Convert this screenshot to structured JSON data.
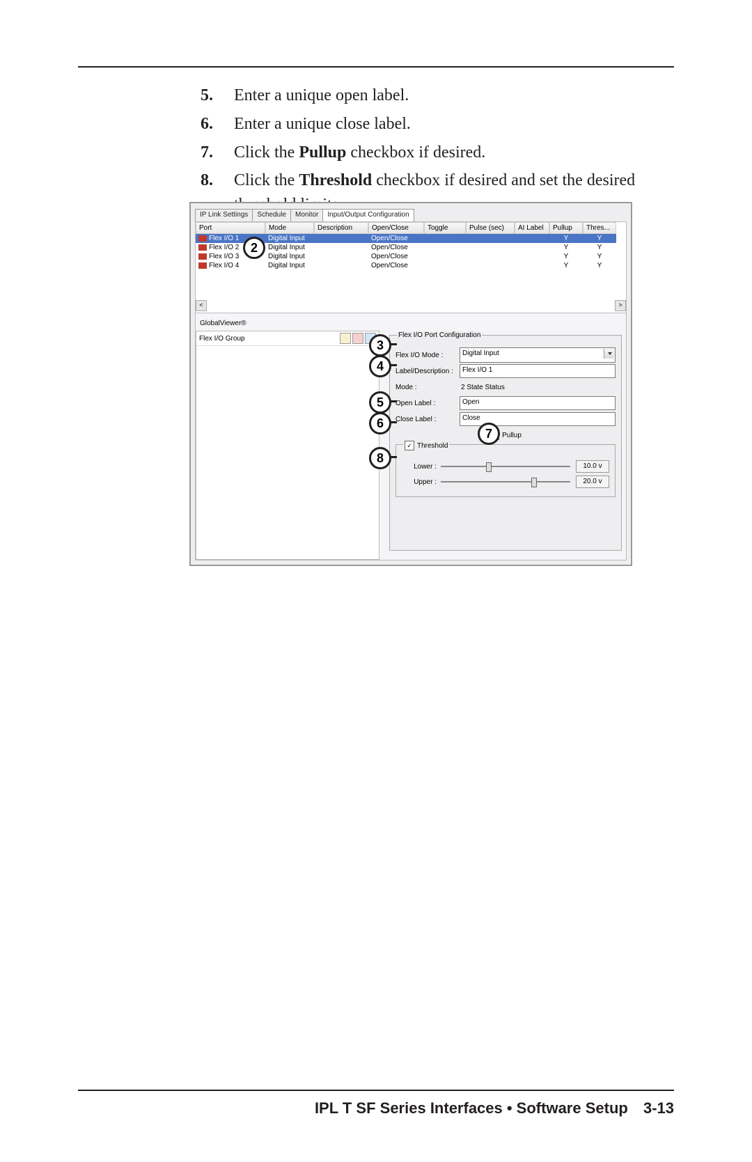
{
  "instructions": [
    {
      "num": "5",
      "text_before": "Enter a unique open label.",
      "bold": "",
      "text_after": ""
    },
    {
      "num": "6",
      "text_before": "Enter a unique close label.",
      "bold": "",
      "text_after": ""
    },
    {
      "num": "7",
      "text_before": "Click the ",
      "bold": "Pullup",
      "text_after": " checkbox if desired."
    },
    {
      "num": "8",
      "text_before": "Click the ",
      "bold": "Threshold",
      "text_after": " checkbox if desired and set the desired threshold limits."
    }
  ],
  "tabs": {
    "t1": "IP Link Settings",
    "t2": "Schedule",
    "t3": "Monitor",
    "t4": "Input/Output Configuration"
  },
  "grid": {
    "headers": {
      "c1": "Port",
      "c2": "Mode",
      "c3": "Description",
      "c4": "Open/Close",
      "c5": "Toggle",
      "c6": "Pulse (sec)",
      "c7": "AI Label",
      "c8": "Pullup",
      "c9": "Thres..."
    },
    "rows": [
      {
        "port": "Flex I/O 1",
        "mode": "Digital Input",
        "desc": "",
        "oc": "Open/Close",
        "tog": "",
        "pulse": "",
        "ai": "",
        "pullup": "Y",
        "thres": "Y",
        "sel": true
      },
      {
        "port": "Flex I/O 2",
        "mode": "Digital Input",
        "desc": "",
        "oc": "Open/Close",
        "tog": "",
        "pulse": "",
        "ai": "",
        "pullup": "Y",
        "thres": "Y",
        "sel": false
      },
      {
        "port": "Flex I/O 3",
        "mode": "Digital Input",
        "desc": "",
        "oc": "Open/Close",
        "tog": "",
        "pulse": "",
        "ai": "",
        "pullup": "Y",
        "thres": "Y",
        "sel": false
      },
      {
        "port": "Flex I/O 4",
        "mode": "Digital Input",
        "desc": "",
        "oc": "Open/Close",
        "tog": "",
        "pulse": "",
        "ai": "",
        "pullup": "Y",
        "thres": "Y",
        "sel": false
      }
    ]
  },
  "gv_label": "GlobalViewer®",
  "tree_label": "Flex I/O Group",
  "cfg": {
    "title": "Flex I/O Port Configuration",
    "mode_lbl": "Flex I/O Mode :",
    "mode_val": "Digital Input",
    "desc_lbl": "Label/Description :",
    "desc_val": "Flex I/O 1",
    "state_lbl": "Mode :",
    "state_val": "2 State Status",
    "open_lbl": "Open Label :",
    "open_val": "Open",
    "close_lbl": "Close Label :",
    "close_val": "Close",
    "pullup_lbl": "Pullup",
    "thresh_lbl": "Threshold",
    "lower_lbl": "Lower :",
    "lower_val": "10.0 v",
    "upper_lbl": "Upper :",
    "upper_val": "20.0 v"
  },
  "callouts": {
    "c2": "2",
    "c3": "3",
    "c4": "4",
    "c5": "5",
    "c6": "6",
    "c7": "7",
    "c8": "8"
  },
  "footer": {
    "title": "IPL T SF Series Interfaces • Software Setup",
    "page": "3-13"
  }
}
